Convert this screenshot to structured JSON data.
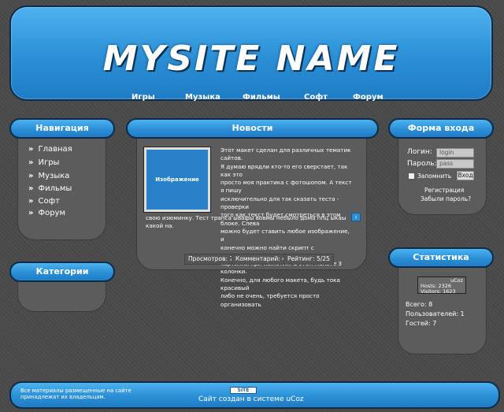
{
  "site": {
    "logo": "MYSITE NAME",
    "nav": [
      "Игры",
      "Музыка",
      "Фильмы",
      "Софт",
      "Форум"
    ]
  },
  "navigation": {
    "title": "Навигация",
    "items": [
      "Главная",
      "Игры",
      "Музыка",
      "Фильмы",
      "Софт",
      "Форум"
    ]
  },
  "categories": {
    "title": "Категории"
  },
  "news": {
    "title": "Новости",
    "image_label": "Изображение",
    "lines": [
      "Этот макет сделан для различных тематик сайтов.",
      "Я думаю врядли кто-то его сверстает, так как это",
      "просто моя практика с фотошопом. А текст я пишу",
      "исключительно для так сказать теста - проверки",
      "того как текст будет смотреться в этом блоке. Слева",
      "можно будет ставить любое изображение, и",
      "конечно можно найти скрипт  с увеличением",
      "картинки при нажатии. В этом макете 3 колонки.",
      "Конечно, для любого макета, будь тока красивый",
      "либо не очень, требуется просто организовать"
    ],
    "last_line": "свою изюминку.  Тест трапса ывафы вовмы небыло дома ппц ыкаы какой на.",
    "more": "›",
    "views": "Просмотров: 7",
    "comments": "Комментарий: 4",
    "rating": "Рейтинг: 5/25"
  },
  "login": {
    "title": "Форма входа",
    "login_label": "Логин:",
    "login_value": "login",
    "pass_label": "Пароль:",
    "pass_value": "pass",
    "remember": "Запомнить",
    "submit": "Вход",
    "register": "Регистрация",
    "forgot": "Забыли пароль?"
  },
  "stats": {
    "title": "Статистика",
    "counter_brand": "uCoz",
    "counter_hosts": "Hosts: 2326",
    "counter_visitors": "Visitors: 1623",
    "total": "Всего: 8",
    "users": "Пользователей: 1",
    "guests": "Гостей: 7"
  },
  "footer": {
    "rights_1": "Все материалы размещенные на сайте",
    "rights_2": "принадлежат   их   владельцам.",
    "badge": "SITE",
    "credit": "Сайт создан в системе  uCoz"
  },
  "colors": {
    "accent": "#2b8fd6",
    "panel": "#5c5c5c",
    "background": "#4a4a4a"
  }
}
